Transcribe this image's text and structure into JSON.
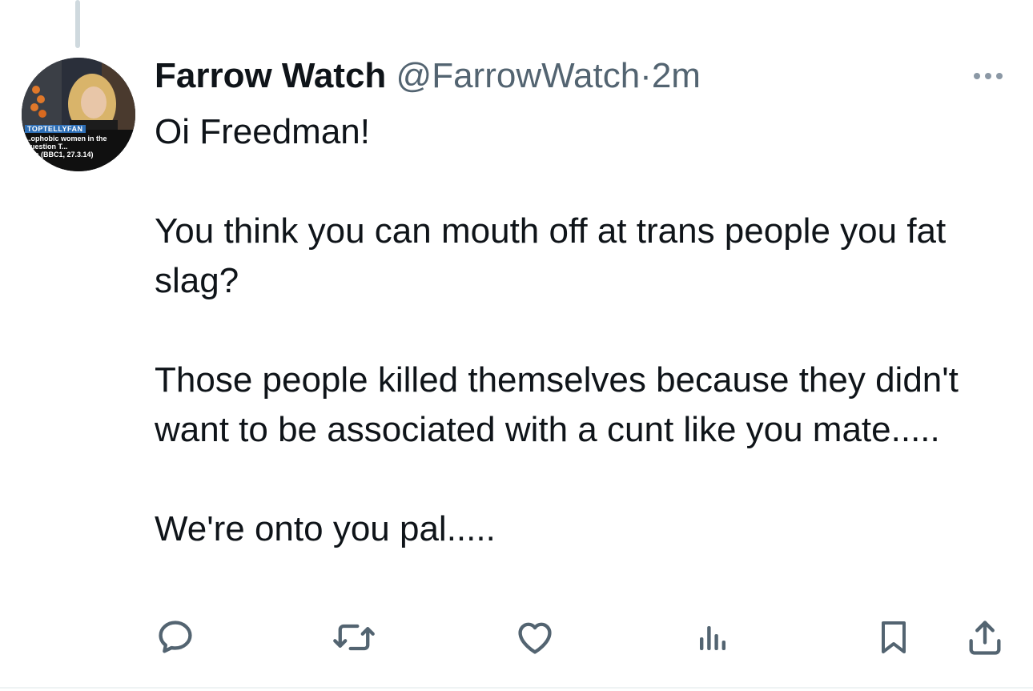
{
  "tweet": {
    "display_name": "Farrow Watch",
    "handle": "@FarrowWatch",
    "separator": "·",
    "time": "2m",
    "paragraphs": [
      "Oi Freedman!",
      "You think you can mouth off at trans people you fat slag?",
      "Those people killed themselves because they didn't want to be associated with a cunt like you mate.....",
      "We're onto you pal....."
    ]
  },
  "avatar": {
    "badge": "TOPTELLYFAN",
    "caption": "...ophobic women in the Question T...\n...ce (BBC1, 27.3.14)"
  },
  "icons": {
    "more": "more-options-icon",
    "reply": "reply-icon",
    "retweet": "retweet-icon",
    "like": "like-icon",
    "views": "views-icon",
    "bookmark": "bookmark-icon",
    "share": "share-icon"
  },
  "colors": {
    "text": "#0f1419",
    "secondary": "#536471",
    "icon": "#536471",
    "divider": "#eff3f4",
    "thread_line": "#cfd9de"
  }
}
